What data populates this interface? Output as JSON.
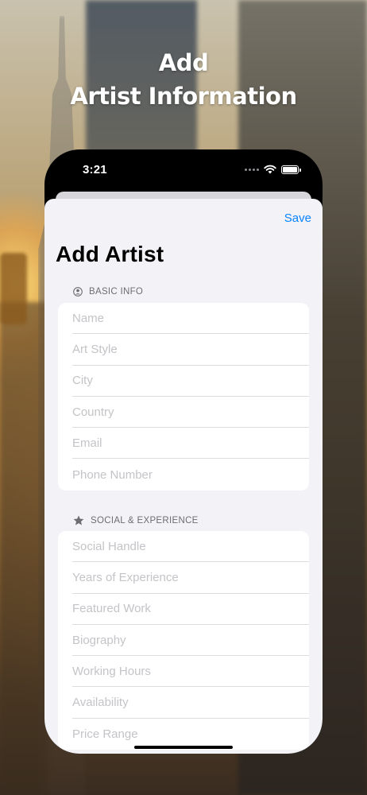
{
  "headline": {
    "line1": "Add",
    "line2": "Artist Information"
  },
  "status_bar": {
    "time": "3:21"
  },
  "sheet": {
    "save_label": "Save",
    "title": "Add Artist",
    "sections": [
      {
        "header": "BASIC INFO",
        "icon": "person-circle-icon",
        "fields": [
          {
            "placeholder": "Name",
            "value": ""
          },
          {
            "placeholder": "Art Style",
            "value": ""
          },
          {
            "placeholder": "City",
            "value": ""
          },
          {
            "placeholder": "Country",
            "value": ""
          },
          {
            "placeholder": "Email",
            "value": ""
          },
          {
            "placeholder": "Phone Number",
            "value": ""
          }
        ]
      },
      {
        "header": "SOCIAL & EXPERIENCE",
        "icon": "star-icon",
        "fields": [
          {
            "placeholder": "Social Handle",
            "value": ""
          },
          {
            "placeholder": "Years of Experience",
            "value": ""
          },
          {
            "placeholder": "Featured Work",
            "value": ""
          },
          {
            "placeholder": "Biography",
            "value": ""
          },
          {
            "placeholder": "Working Hours",
            "value": ""
          },
          {
            "placeholder": "Availability",
            "value": ""
          },
          {
            "placeholder": "Price Range",
            "value": ""
          }
        ]
      }
    ]
  },
  "colors": {
    "accent": "#0a84ff",
    "sheet_background": "#f2f2f7",
    "placeholder": "#c4c4c8"
  }
}
